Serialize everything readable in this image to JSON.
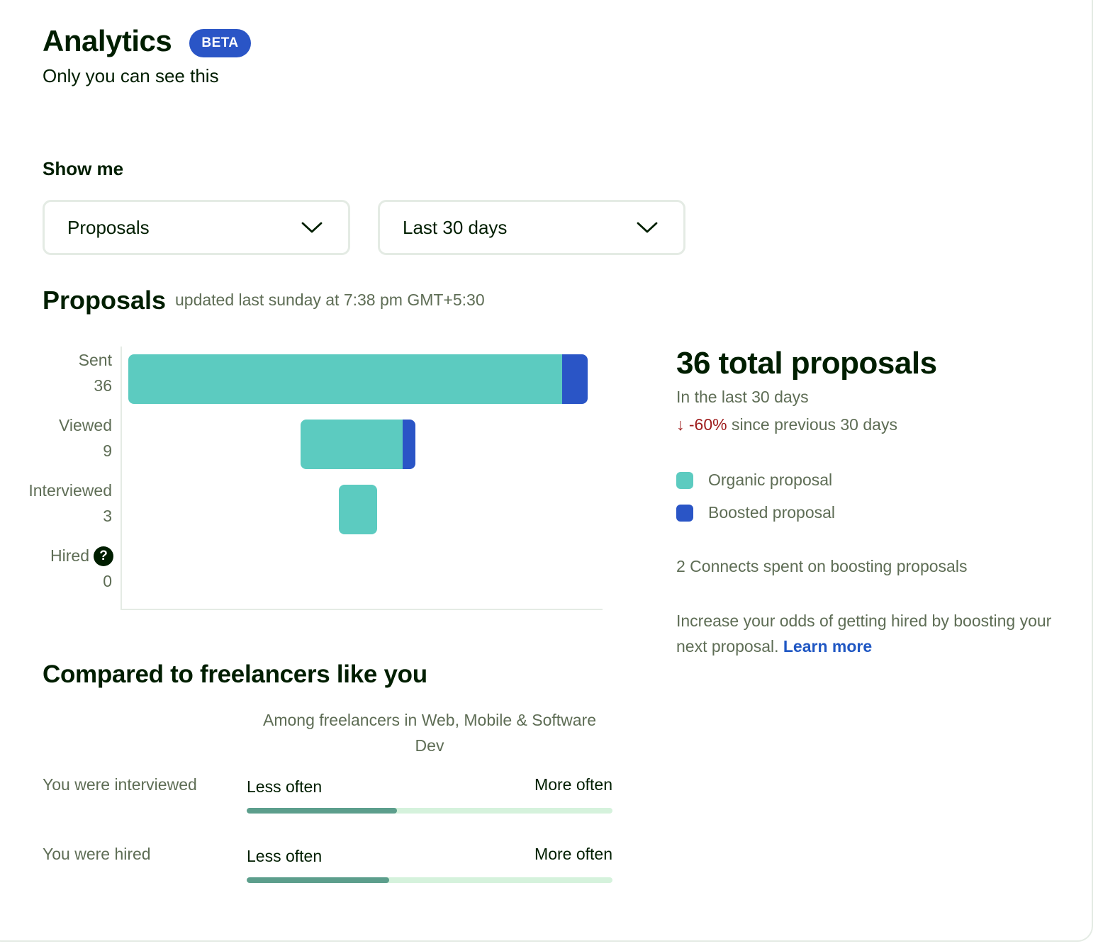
{
  "header": {
    "title": "Analytics",
    "badge": "BETA",
    "subtitle": "Only you can see this"
  },
  "filters": {
    "label": "Show me",
    "metric_select": {
      "value": "Proposals"
    },
    "period_select": {
      "value": "Last 30 days"
    }
  },
  "section": {
    "title": "Proposals",
    "updated": "updated last sunday at 7:38 pm GMT+5:30"
  },
  "chart_data": {
    "type": "bar",
    "orientation": "horizontal-funnel",
    "categories": [
      "Sent",
      "Viewed",
      "Interviewed",
      "Hired"
    ],
    "totals": [
      36,
      9,
      3,
      0
    ],
    "series": [
      {
        "name": "Organic proposal",
        "values": [
          34,
          8,
          3,
          0
        ],
        "color": "#5ccbc0"
      },
      {
        "name": "Boosted proposal",
        "values": [
          2,
          1,
          0,
          0
        ],
        "color": "#2a55c6"
      }
    ],
    "hired_help_icon": "question-circle-icon",
    "grid": false
  },
  "summary": {
    "total": "36 total proposals",
    "period": "In the last 30 days",
    "change_arrow": "↓",
    "change_value": "-60%",
    "change_text": "since previous 30 days",
    "legend": [
      {
        "label": "Organic proposal",
        "color": "#5ccbc0"
      },
      {
        "label": "Boosted proposal",
        "color": "#2a55c6"
      }
    ],
    "connects": "2 Connects spent on boosting proposals",
    "tip": "Increase your odds of getting hired by boosting your next proposal.",
    "learn_more": "Learn more"
  },
  "comparison": {
    "title": "Compared to freelancers like you",
    "subtitle": "Among freelancers in Web, Mobile & Software Dev",
    "rows": [
      {
        "label": "You were interviewed",
        "left": "Less often",
        "right": "More often",
        "level": 0.41
      },
      {
        "label": "You were hired",
        "left": "Less often",
        "right": "More often",
        "level": 0.39
      }
    ]
  }
}
